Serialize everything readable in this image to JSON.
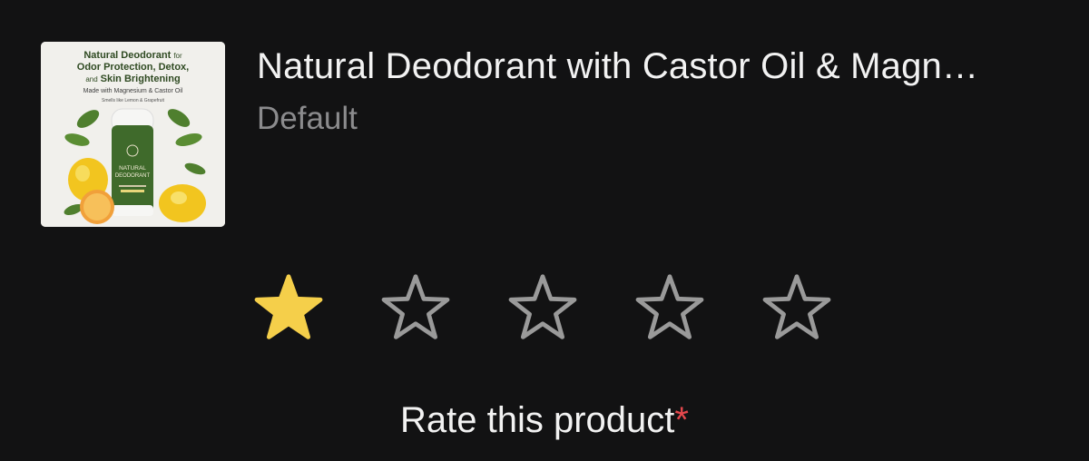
{
  "product": {
    "title": "Natural Deodorant with Castor Oil & Magn…",
    "variant": "Default",
    "image": {
      "headline_1": "Natural Deodorant",
      "headline_1_suffix": "for",
      "headline_2": "Odor Protection, Detox,",
      "headline_3_prefix": "and",
      "headline_3": "Skin Brightening",
      "subline_1": "Made with Magnesium & Castor Oil",
      "subline_2": "Smells like Lemon & Grapefruit",
      "label_line_1": "NATURAL",
      "label_line_2": "DEODORANT"
    }
  },
  "rating": {
    "value": 1,
    "max": 5,
    "filled_color": "#f5cf4a",
    "empty_color": "#9a9a9a"
  },
  "prompt": {
    "label": "Rate this product",
    "required_marker": "*"
  },
  "icons": [
    "star-filled-icon",
    "star-outline-icon"
  ]
}
